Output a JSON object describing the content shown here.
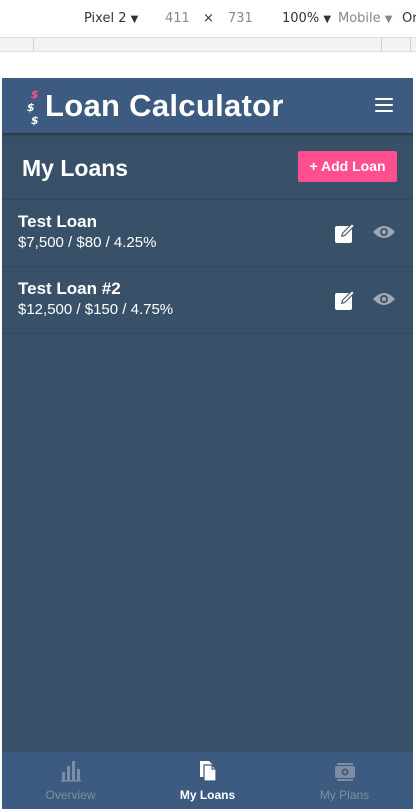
{
  "devtools": {
    "device": "Pixel 2",
    "width": "411",
    "times": "×",
    "height": "731",
    "zoom": "100%",
    "mode": "Mobile",
    "overflow_text": "Or",
    "caret": "▼"
  },
  "app": {
    "title": "Loan Calculator",
    "logo_chars": [
      "$",
      "$",
      "$"
    ]
  },
  "section": {
    "title": "My Loans",
    "add_button_label": "+ Add Loan"
  },
  "loans": [
    {
      "name": "Test Loan",
      "summary": "$7,500 / $80 / 4.25%"
    },
    {
      "name": "Test Loan #2",
      "summary": "$12,500 / $150 / 4.75%"
    }
  ],
  "nav": {
    "items": [
      {
        "label": "Overview",
        "icon": "bar-chart-icon",
        "active": false
      },
      {
        "label": "My Loans",
        "icon": "documents-icon",
        "active": true
      },
      {
        "label": "My Plans",
        "icon": "money-icon",
        "active": false
      }
    ]
  },
  "colors": {
    "header": "#3d5a80",
    "background": "#385169",
    "accent": "#ff4f8e"
  }
}
